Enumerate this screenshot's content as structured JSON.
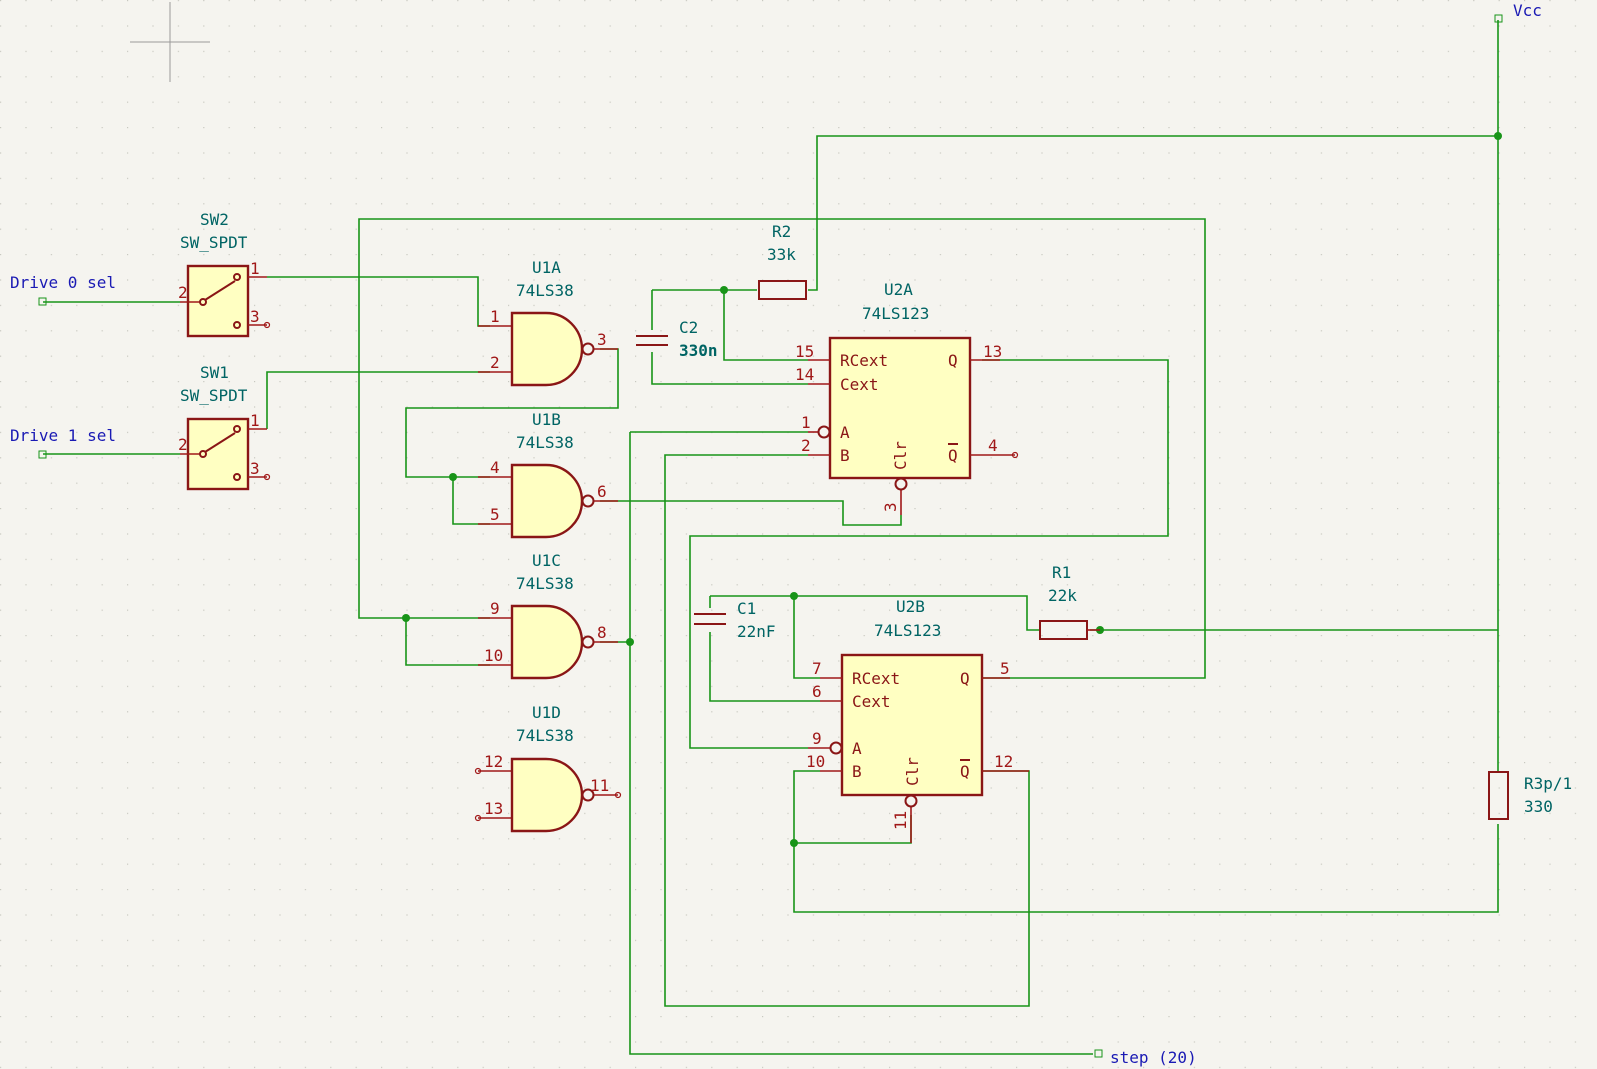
{
  "components": {
    "sw2": {
      "ref": "SW2",
      "value": "SW_SPDT",
      "pins": [
        "1",
        "2",
        "3"
      ]
    },
    "sw1": {
      "ref": "SW1",
      "value": "SW_SPDT",
      "pins": [
        "1",
        "2",
        "3"
      ]
    },
    "u1a": {
      "ref": "U1A",
      "value": "74LS38",
      "pins": [
        "1",
        "2",
        "3"
      ]
    },
    "u1b": {
      "ref": "U1B",
      "value": "74LS38",
      "pins": [
        "4",
        "5",
        "6"
      ]
    },
    "u1c": {
      "ref": "U1C",
      "value": "74LS38",
      "pins": [
        "9",
        "10",
        "8"
      ]
    },
    "u1d": {
      "ref": "U1D",
      "value": "74LS38",
      "pins": [
        "12",
        "13",
        "11"
      ]
    },
    "u2a": {
      "ref": "U2A",
      "value": "74LS123",
      "pins": [
        "15",
        "14",
        "1",
        "2",
        "13",
        "4",
        "3"
      ],
      "pin_names": [
        "RCext",
        "Cext",
        "A",
        "B",
        "Q",
        "Q",
        "Clr"
      ]
    },
    "u2b": {
      "ref": "U2B",
      "value": "74LS123",
      "pins": [
        "7",
        "6",
        "9",
        "10",
        "5",
        "12",
        "11"
      ],
      "pin_names": [
        "RCext",
        "Cext",
        "A",
        "B",
        "Q",
        "Q",
        "Clr"
      ]
    },
    "r2": {
      "ref": "R2",
      "value": "33k"
    },
    "r1": {
      "ref": "R1",
      "value": "22k"
    },
    "r3": {
      "ref": "R3p/1",
      "value": "330"
    },
    "c2": {
      "ref": "C2",
      "value": "330n"
    },
    "c1": {
      "ref": "C1",
      "value": "22nF"
    }
  },
  "net_labels": {
    "drive0": "Drive 0 sel",
    "drive1": "Drive 1 sel",
    "vcc": "Vcc",
    "step": "step (20)"
  },
  "colors": {
    "background": "#f5f4ef",
    "wire": "#189418",
    "symbol_outline": "#8a1616",
    "symbol_fill": "#ffffc2",
    "pin": "#a01818",
    "reference_text": "#006464",
    "net_label": "#1a1ab4"
  }
}
